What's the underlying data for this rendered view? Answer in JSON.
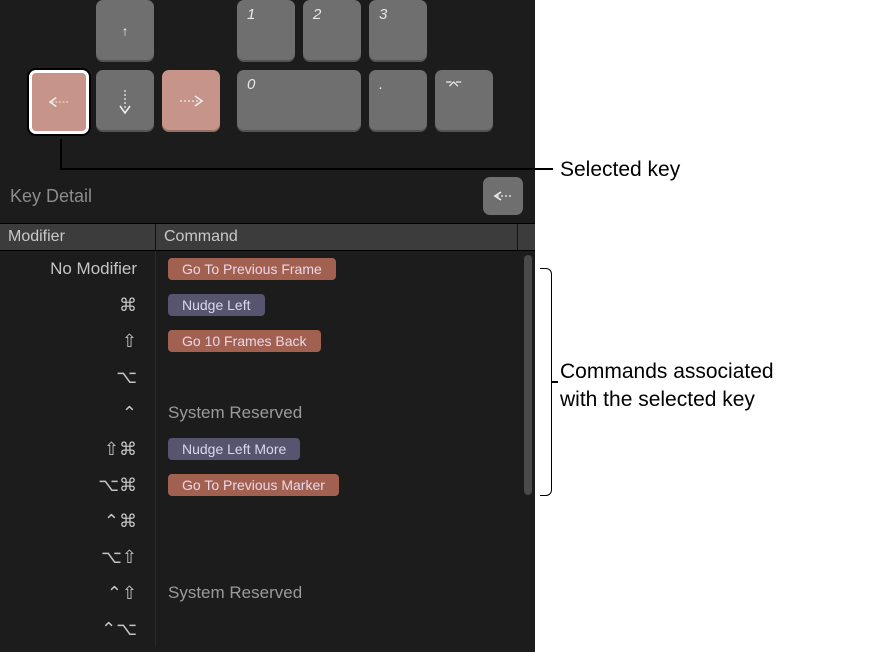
{
  "keyboard": {
    "top_keys": [
      {
        "id": "up",
        "glyph": "↑"
      },
      {
        "id": "n1",
        "glyph": "1"
      },
      {
        "id": "n2",
        "glyph": "2"
      },
      {
        "id": "n3",
        "glyph": "3"
      }
    ],
    "bottom_keys": [
      {
        "id": "left",
        "glyph": "←"
      },
      {
        "id": "down",
        "glyph": "↓"
      },
      {
        "id": "right",
        "glyph": "→"
      },
      {
        "id": "n0",
        "glyph": "0"
      },
      {
        "id": "dot",
        "glyph": "."
      },
      {
        "id": "enter",
        "glyph": "⌤"
      }
    ]
  },
  "key_detail": {
    "title": "Key Detail",
    "selected_glyph": "←",
    "columns": {
      "modifier": "Modifier",
      "command": "Command"
    },
    "rows": [
      {
        "modifier_text": "No Modifier",
        "modifier_glyph": "",
        "command": "Go To Previous Frame",
        "style": "orange"
      },
      {
        "modifier_text": "",
        "modifier_glyph": "⌘",
        "command": "Nudge Left",
        "style": "purple"
      },
      {
        "modifier_text": "",
        "modifier_glyph": "⇧",
        "command": "Go 10 Frames Back",
        "style": "orange"
      },
      {
        "modifier_text": "",
        "modifier_glyph": "⌥",
        "command": "",
        "style": ""
      },
      {
        "modifier_text": "",
        "modifier_glyph": "⌃",
        "command": "System Reserved",
        "style": "sys"
      },
      {
        "modifier_text": "",
        "modifier_glyph": "⇧⌘",
        "command": "Nudge Left More",
        "style": "purple"
      },
      {
        "modifier_text": "",
        "modifier_glyph": "⌥⌘",
        "command": "Go To Previous Marker",
        "style": "orange"
      },
      {
        "modifier_text": "",
        "modifier_glyph": "⌃⌘",
        "command": "",
        "style": ""
      },
      {
        "modifier_text": "",
        "modifier_glyph": "⌥⇧",
        "command": "",
        "style": ""
      },
      {
        "modifier_text": "",
        "modifier_glyph": "⌃⇧",
        "command": "System Reserved",
        "style": "sys"
      },
      {
        "modifier_text": "",
        "modifier_glyph": "⌃⌥",
        "command": "",
        "style": ""
      }
    ]
  },
  "annotations": {
    "selected_key": "Selected key",
    "commands_line1": "Commands associated",
    "commands_line2": "with the selected key"
  }
}
